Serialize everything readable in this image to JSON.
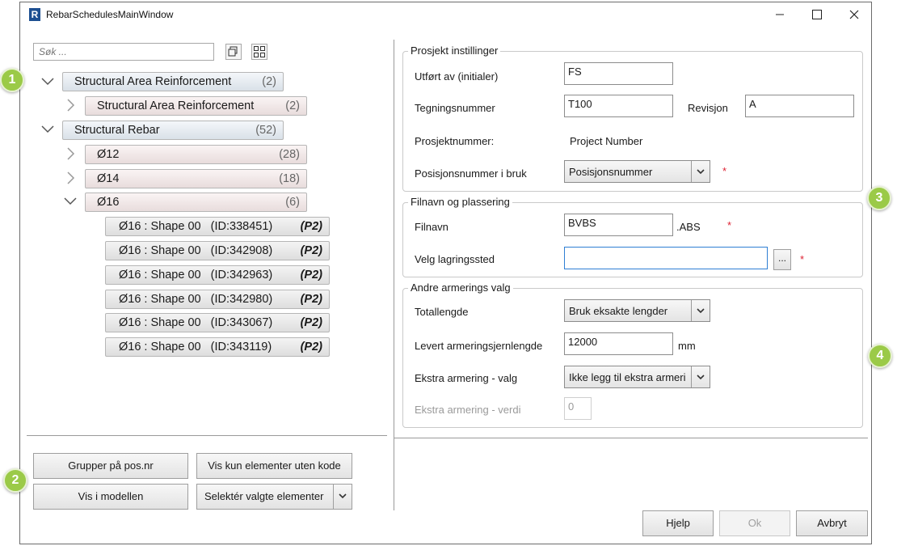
{
  "window": {
    "title": "RebarSchedulesMainWindow",
    "app_letter": "R"
  },
  "left": {
    "search_placeholder": "Søk ...",
    "tree": {
      "area_group": {
        "label": "Structural Area Reinforcement",
        "count": "(2)"
      },
      "area_child": {
        "label": "Structural Area Reinforcement",
        "count": "(2)"
      },
      "rebar_group": {
        "label": "Structural Rebar",
        "count": "(52)"
      },
      "d12": {
        "label": "Ø12",
        "count": "(28)"
      },
      "d14": {
        "label": "Ø14",
        "count": "(18)"
      },
      "d16": {
        "label": "Ø16",
        "count": "(6)"
      },
      "leaves": [
        {
          "label": "Ø16 : Shape 00   (ID:338451)",
          "tag": "(P2)"
        },
        {
          "label": "Ø16 : Shape 00   (ID:342908)",
          "tag": "(P2)"
        },
        {
          "label": "Ø16 : Shape 00   (ID:342963)",
          "tag": "(P2)"
        },
        {
          "label": "Ø16 : Shape 00   (ID:342980)",
          "tag": "(P2)"
        },
        {
          "label": "Ø16 : Shape 00   (ID:343067)",
          "tag": "(P2)"
        },
        {
          "label": "Ø16 : Shape 00   (ID:343119)",
          "tag": "(P2)"
        }
      ]
    },
    "buttons": {
      "group_by": "Grupper på pos.nr",
      "show_no_code": "Vis kun elementer uten kode",
      "show_in_model": "Vis i modellen",
      "select_elements": "Selektér valgte elementer"
    }
  },
  "project": {
    "title": "Prosjekt instillinger",
    "done_by_label": "Utført av (initialer)",
    "done_by_value": "FS",
    "drawing_label": "Tegningsnummer",
    "drawing_value": "T100",
    "revision_label": "Revisjon",
    "revision_value": "A",
    "project_number_label": "Prosjektnummer:",
    "project_number_value": "Project Number",
    "position_label": "Posisjonsnummer i bruk",
    "position_value": "Posisjonsnummer"
  },
  "file": {
    "title": "Filnavn og plassering",
    "filename_label": "Filnavn",
    "filename_value": "BVBS",
    "extension": ".ABS",
    "location_label": "Velg lagringssted",
    "location_value": "",
    "browse_label": "..."
  },
  "other": {
    "title": "Andre armerings valg",
    "total_length_label": "Totallengde",
    "total_length_value": "Bruk eksakte lengder",
    "delivered_label": "Levert armeringsjernlengde",
    "delivered_value": "12000",
    "delivered_unit": "mm",
    "extra_choice_label": "Ekstra armering - valg",
    "extra_choice_value": "Ikke legg til ekstra armeri",
    "extra_value_label": "Ekstra armering - verdi",
    "extra_value_value": "0"
  },
  "footer": {
    "help": "Hjelp",
    "ok": "Ok",
    "cancel": "Avbryt"
  },
  "required_mark": "*",
  "badges": [
    "1",
    "2",
    "3",
    "4"
  ],
  "colors": {
    "badge": "#9bca48",
    "required": "#d23",
    "focus_border": "#2f7fd4"
  }
}
